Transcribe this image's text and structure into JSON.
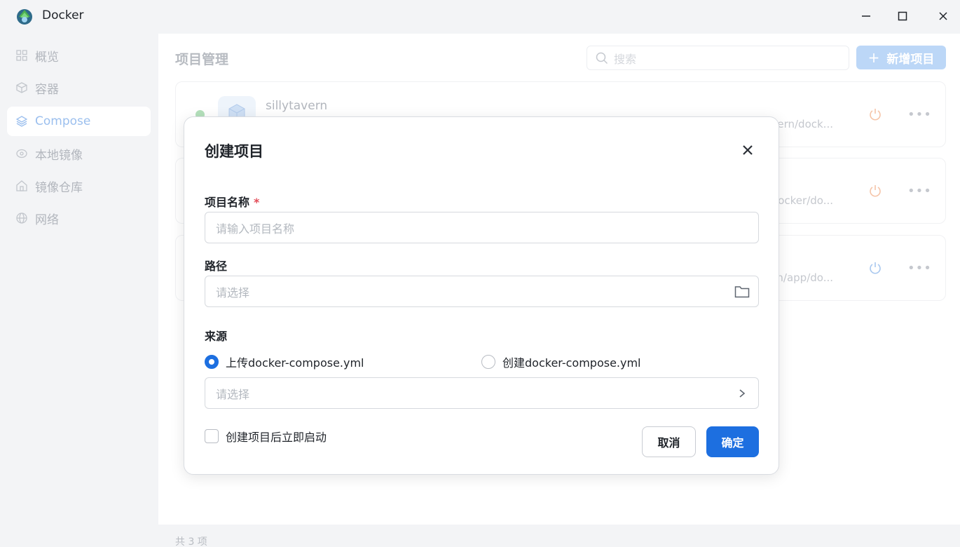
{
  "window": {
    "title": "Docker",
    "controls": [
      "minimize-icon",
      "maximize-icon",
      "close-icon"
    ]
  },
  "sidebar": {
    "items": [
      {
        "label": "概览",
        "icon": "grid-icon",
        "active": false
      },
      {
        "label": "容器",
        "icon": "cube-icon",
        "active": false
      },
      {
        "label": "Compose",
        "icon": "layers-icon",
        "active": true
      },
      {
        "label": "本地镜像",
        "icon": "disc-icon",
        "active": false
      },
      {
        "label": "镜像仓库",
        "icon": "home-icon",
        "active": false
      },
      {
        "label": "网络",
        "icon": "globe-icon",
        "active": false
      }
    ]
  },
  "main": {
    "title": "项目管理",
    "search_placeholder": "搜索",
    "add_button": "新增项目",
    "add_plus": "+",
    "projects": [
      {
        "name": "sillytavern",
        "path": "vern/dock...",
        "status": "running",
        "power_color": "#f5c4a8"
      },
      {
        "name": "",
        "path": "ocker/do...",
        "status": "",
        "power_color": "#f5c4a8"
      },
      {
        "name": "",
        "path": "n/app/do...",
        "status": "",
        "power_color": "#a9c8ef"
      }
    ],
    "more_label": "•••",
    "footer_count": "共 3 项"
  },
  "dialog": {
    "title": "创建项目",
    "name_label": "项目名称",
    "required_mark": "*",
    "name_placeholder": "请输入项目名称",
    "path_label": "路径",
    "path_placeholder": "请选择",
    "source_label": "来源",
    "source_options": [
      {
        "label": "上传docker-compose.yml",
        "checked": true
      },
      {
        "label": "创建docker-compose.yml",
        "checked": false
      }
    ],
    "source_placeholder": "请选择",
    "autostart_label": "创建项目后立即启动",
    "autostart_checked": false,
    "cancel_label": "取消",
    "ok_label": "确定"
  },
  "colors": {
    "primary": "#1d6fe0",
    "primary_disabled": "#bcd7f7",
    "running_dot": "#b4e0bb",
    "required": "#e34d59"
  }
}
